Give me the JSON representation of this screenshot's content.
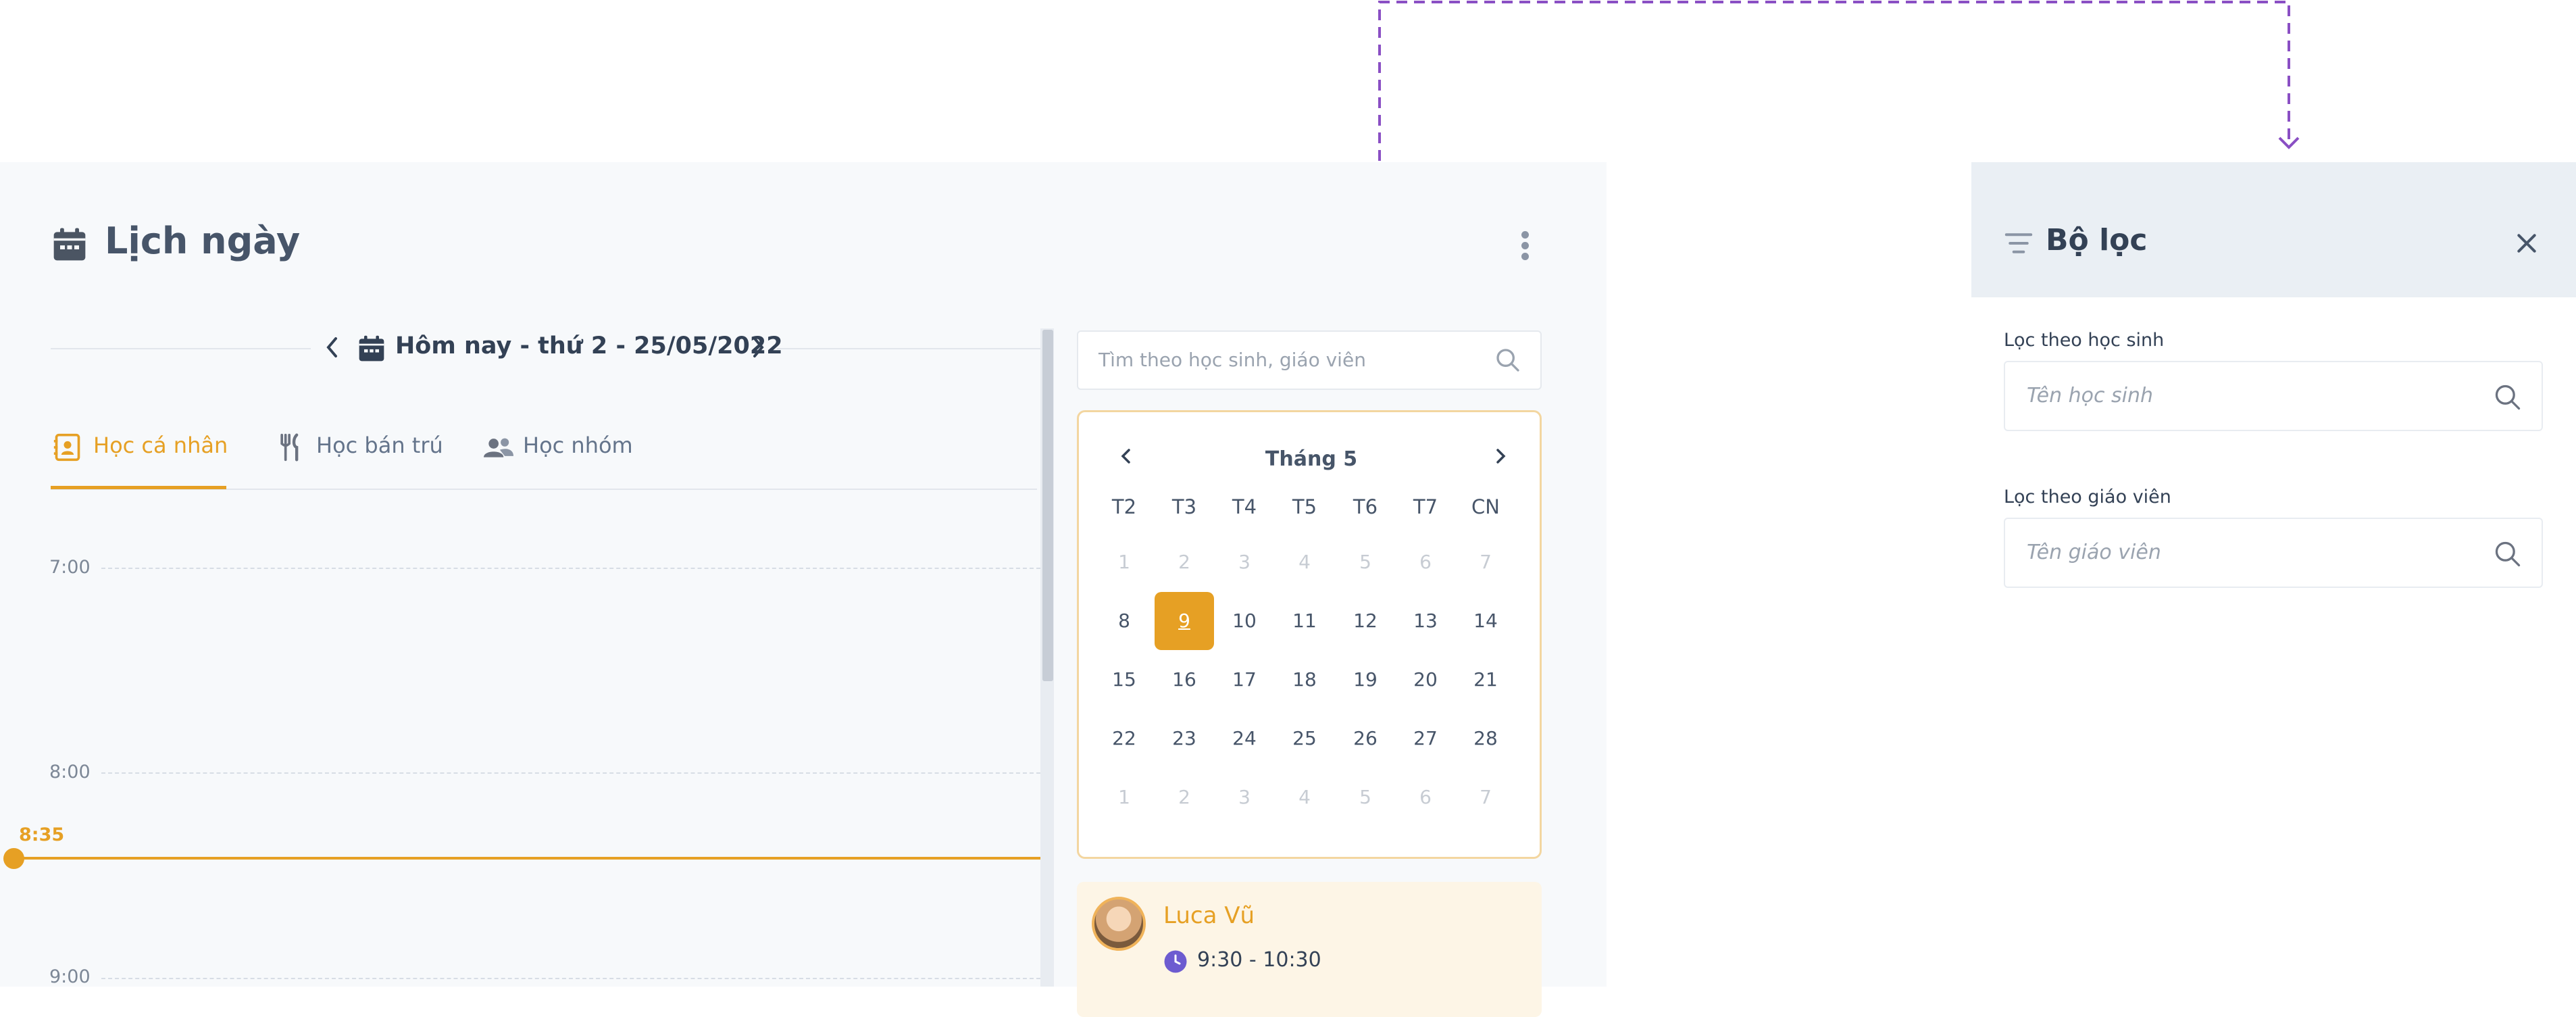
{
  "page": {
    "title": "Lịch ngày",
    "date_label": "Hôm nay - thứ 2 - 25/05/2022"
  },
  "tabs": [
    {
      "label": "Học cá nhân",
      "icon": "contact-book-icon",
      "active": true
    },
    {
      "label": "Học bán trú",
      "icon": "utensils-icon",
      "active": false
    },
    {
      "label": "Học nhóm",
      "icon": "users-icon",
      "active": false
    }
  ],
  "timeline": {
    "times": [
      "7:00",
      "8:00",
      "9:00"
    ],
    "now": "8:35"
  },
  "search": {
    "placeholder": "Tìm theo học sinh, giáo viên"
  },
  "calendar": {
    "month": "Tháng 5",
    "weekdays": [
      "T2",
      "T3",
      "T4",
      "T5",
      "T6",
      "T7",
      "CN"
    ],
    "weeks": [
      [
        "1",
        "2",
        "3",
        "4",
        "5",
        "6",
        "7"
      ],
      [
        "8",
        "9",
        "10",
        "11",
        "12",
        "13",
        "14"
      ],
      [
        "15",
        "16",
        "17",
        "18",
        "19",
        "20",
        "21"
      ],
      [
        "22",
        "23",
        "24",
        "25",
        "26",
        "27",
        "28"
      ],
      [
        "1",
        "2",
        "3",
        "4",
        "5",
        "6",
        "7"
      ]
    ],
    "selected": "9"
  },
  "event": {
    "name": "Luca Vũ",
    "time": "9:30 - 10:30"
  },
  "filter": {
    "title": "Bộ lọc",
    "student_label": "Lọc theo học sinh",
    "student_placeholder": "Tên học sinh",
    "teacher_label": "Lọc theo giáo viên",
    "teacher_placeholder": "Tên giáo viên"
  },
  "colors": {
    "accent": "#e6a024",
    "connector": "#8a4fc4",
    "panel_bg": "#f7f9fb",
    "filter_header_bg": "#eaeff4"
  }
}
